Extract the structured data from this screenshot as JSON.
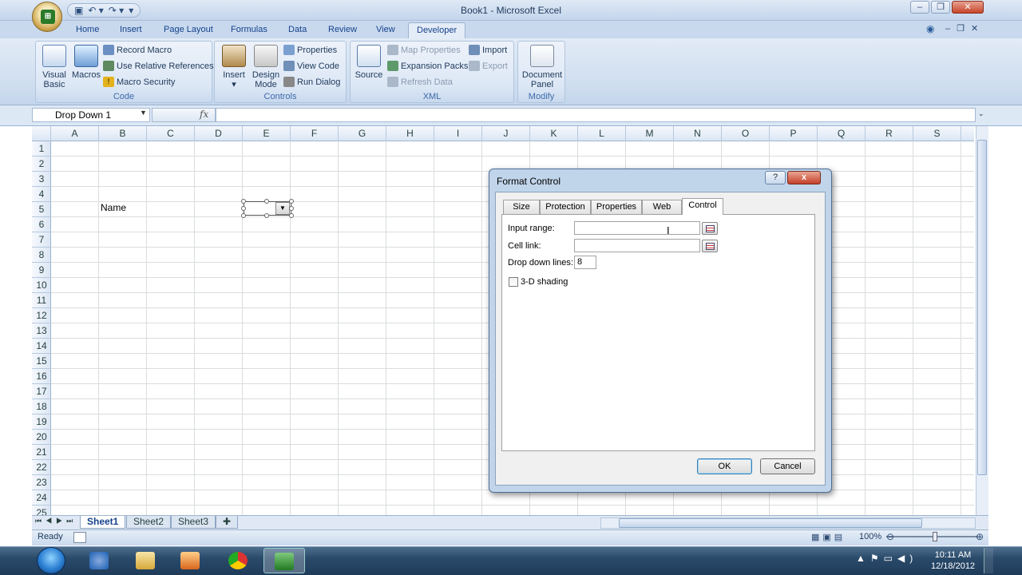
{
  "title": "Book1 - Microsoft Excel",
  "ribbon": {
    "tabs": [
      "Home",
      "Insert",
      "Page Layout",
      "Formulas",
      "Data",
      "Review",
      "View",
      "Developer"
    ],
    "active_tab": "Developer",
    "groups": {
      "code": {
        "label": "Code",
        "visual_basic": "Visual Basic",
        "macros": "Macros",
        "record_macro": "Record Macro",
        "use_relative": "Use Relative References",
        "macro_security": "Macro Security"
      },
      "controls": {
        "label": "Controls",
        "insert": "Insert",
        "design_mode": "Design Mode",
        "properties": "Properties",
        "view_code": "View Code",
        "run_dialog": "Run Dialog"
      },
      "xml": {
        "label": "XML",
        "source": "Source",
        "map_properties": "Map Properties",
        "expansion_packs": "Expansion Packs",
        "refresh_data": "Refresh Data",
        "import": "Import",
        "export": "Export"
      },
      "modify": {
        "label": "Modify",
        "document_panel": "Document Panel"
      }
    }
  },
  "formula_bar": {
    "name_box": "Drop Down 1",
    "fx": "fx",
    "formula": ""
  },
  "grid": {
    "columns": [
      "A",
      "B",
      "C",
      "D",
      "E",
      "F",
      "G",
      "H",
      "I",
      "J",
      "K",
      "L",
      "M",
      "N",
      "O",
      "P",
      "Q",
      "R",
      "S"
    ],
    "rows": [
      "1",
      "2",
      "3",
      "4",
      "5",
      "6",
      "7",
      "8",
      "9",
      "10",
      "11",
      "12",
      "13",
      "14",
      "15",
      "16",
      "17",
      "18",
      "19",
      "20",
      "21",
      "22",
      "23",
      "24",
      "25"
    ],
    "cell_b5": "Name"
  },
  "sheets": [
    "Sheet1",
    "Sheet2",
    "Sheet3"
  ],
  "status": {
    "ready": "Ready",
    "zoom": "100%"
  },
  "dialog": {
    "title": "Format Control",
    "help": "?",
    "close": "x",
    "tabs": [
      "Size",
      "Protection",
      "Properties",
      "Web",
      "Control"
    ],
    "active_tab": "Control",
    "input_range_label": "Input range:",
    "input_range_value": "",
    "cell_link_label": "Cell link:",
    "cell_link_value": "",
    "drop_down_lines_label": "Drop down lines:",
    "drop_down_lines_value": "8",
    "shading_label": "3-D shading",
    "ok": "OK",
    "cancel": "Cancel"
  },
  "taskbar": {
    "time": "10:11 AM",
    "date": "12/18/2012"
  }
}
